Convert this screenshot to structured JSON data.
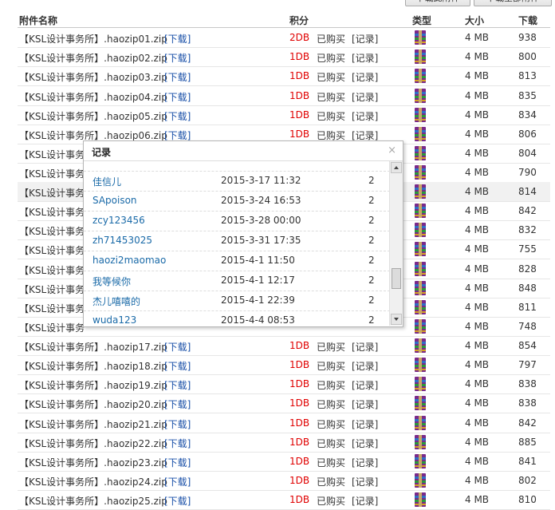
{
  "header": {
    "top_buttons": [
      "下载此附件",
      "下载全部附件"
    ],
    "columns": {
      "name": "附件名称",
      "price": "积分",
      "type": "类型",
      "size": "大小",
      "downloads": "下载"
    }
  },
  "dl_label": "[下载]",
  "bought_label": "已购买",
  "record_label": "[记录]",
  "rows": [
    {
      "name": "【KSL设计事务所】.haozip01.zip",
      "price": "2DB",
      "size": "4 MB",
      "downloads": "938"
    },
    {
      "name": "【KSL设计事务所】.haozip02.zip",
      "price": "1DB",
      "size": "4 MB",
      "downloads": "800"
    },
    {
      "name": "【KSL设计事务所】.haozip03.zip",
      "price": "1DB",
      "size": "4 MB",
      "downloads": "813"
    },
    {
      "name": "【KSL设计事务所】.haozip04.zip",
      "price": "1DB",
      "size": "4 MB",
      "downloads": "835"
    },
    {
      "name": "【KSL设计事务所】.haozip05.zip",
      "price": "1DB",
      "size": "4 MB",
      "downloads": "834"
    },
    {
      "name": "【KSL设计事务所】.haozip06.zip",
      "price": "1DB",
      "size": "4 MB",
      "downloads": "806"
    },
    {
      "name": "【KSL设计事务",
      "price": "",
      "size": "4 MB",
      "downloads": "804"
    },
    {
      "name": "【KSL设计事务",
      "price": "",
      "size": "4 MB",
      "downloads": "790"
    },
    {
      "name": "【KSL设计事务",
      "price": "",
      "size": "4 MB",
      "downloads": "814"
    },
    {
      "name": "【KSL设计事务",
      "price": "",
      "size": "4 MB",
      "downloads": "842"
    },
    {
      "name": "【KSL设计事务",
      "price": "",
      "size": "4 MB",
      "downloads": "832"
    },
    {
      "name": "【KSL设计事务",
      "price": "",
      "size": "4 MB",
      "downloads": "755"
    },
    {
      "name": "【KSL设计事务",
      "price": "",
      "size": "4 MB",
      "downloads": "828"
    },
    {
      "name": "【KSL设计事务",
      "price": "",
      "size": "4 MB",
      "downloads": "848"
    },
    {
      "name": "【KSL设计事务",
      "price": "",
      "size": "4 MB",
      "downloads": "811"
    },
    {
      "name": "【KSL设计事务",
      "price": "",
      "size": "4 MB",
      "downloads": "748"
    },
    {
      "name": "【KSL设计事务所】.haozip17.zip",
      "price": "1DB",
      "size": "4 MB",
      "downloads": "854"
    },
    {
      "name": "【KSL设计事务所】.haozip18.zip",
      "price": "1DB",
      "size": "4 MB",
      "downloads": "797"
    },
    {
      "name": "【KSL设计事务所】.haozip19.zip",
      "price": "1DB",
      "size": "4 MB",
      "downloads": "838"
    },
    {
      "name": "【KSL设计事务所】.haozip20.zip",
      "price": "1DB",
      "size": "4 MB",
      "downloads": "838"
    },
    {
      "name": "【KSL设计事务所】.haozip21.zip",
      "price": "1DB",
      "size": "4 MB",
      "downloads": "842"
    },
    {
      "name": "【KSL设计事务所】.haozip22.zip",
      "price": "1DB",
      "size": "4 MB",
      "downloads": "885"
    },
    {
      "name": "【KSL设计事务所】.haozip23.zip",
      "price": "1DB",
      "size": "4 MB",
      "downloads": "841"
    },
    {
      "name": "【KSL设计事务所】.haozip24.zip",
      "price": "1DB",
      "size": "4 MB",
      "downloads": "802"
    },
    {
      "name": "【KSL设计事务所】.haozip25.zip",
      "price": "1DB",
      "size": "4 MB",
      "downloads": "810"
    }
  ],
  "dialog": {
    "title": "记录",
    "close": "×",
    "records": [
      {
        "user": "佳信儿",
        "time": "2015-3-17 11:32",
        "count": "2"
      },
      {
        "user": "SApoison",
        "time": "2015-3-24 16:53",
        "count": "2"
      },
      {
        "user": "zcy123456",
        "time": "2015-3-28 00:00",
        "count": "2"
      },
      {
        "user": "zh71453025",
        "time": "2015-3-31 17:35",
        "count": "2"
      },
      {
        "user": "haozi2maomao",
        "time": "2015-4-1 11:50",
        "count": "2"
      },
      {
        "user": "我等候你",
        "time": "2015-4-1 12:17",
        "count": "2"
      },
      {
        "user": "杰儿嘻嘻的",
        "time": "2015-4-1 22:39",
        "count": "2"
      },
      {
        "user": "wuda123",
        "time": "2015-4-4 08:53",
        "count": "2"
      }
    ]
  },
  "colors": {
    "price": "#e00000",
    "link": "#1a50a8",
    "user_link": "#1a6aa8"
  },
  "icon_name": "winrar-archive-icon"
}
